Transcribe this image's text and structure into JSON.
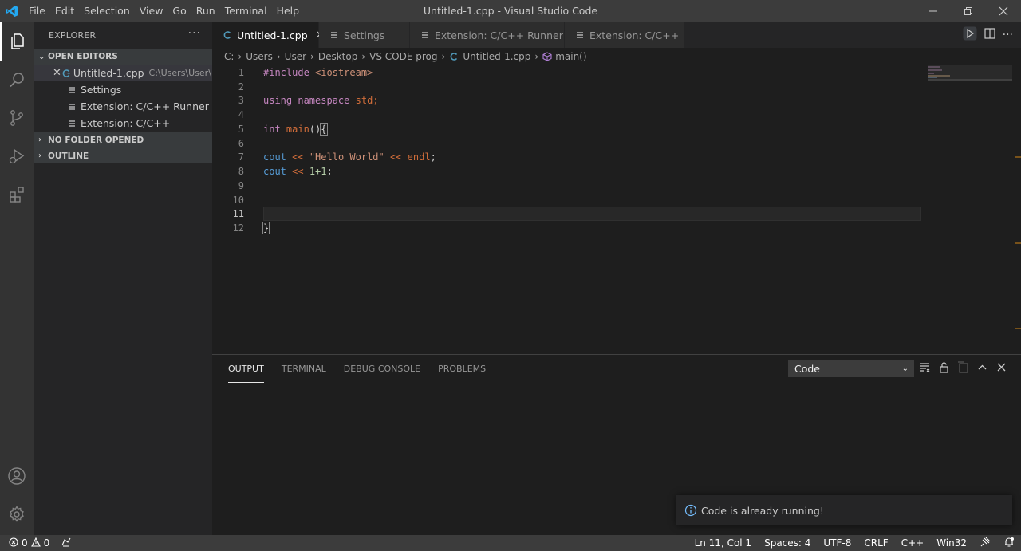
{
  "titlebar": {
    "title": "Untitled-1.cpp - Visual Studio Code",
    "menu": [
      "File",
      "Edit",
      "Selection",
      "View",
      "Go",
      "Run",
      "Terminal",
      "Help"
    ]
  },
  "sidebar": {
    "title": "EXPLORER",
    "open_editors_label": "OPEN EDITORS",
    "open_editors": [
      {
        "name": "Untitled-1.cpp",
        "path": "C:\\Users\\User\\...",
        "icon": "cpp-file-icon"
      },
      {
        "name": "Settings",
        "icon": "settings-file-icon"
      },
      {
        "name": "Extension: C/C++ Runner",
        "icon": "extension-file-icon"
      },
      {
        "name": "Extension: C/C++",
        "icon": "extension-file-icon"
      }
    ],
    "no_folder_label": "NO FOLDER OPENED",
    "outline_label": "OUTLINE"
  },
  "tabs": [
    {
      "label": "Untitled-1.cpp",
      "active": true
    },
    {
      "label": "Settings"
    },
    {
      "label": "Extension: C/C++ Runner"
    },
    {
      "label": "Extension: C/C++"
    }
  ],
  "breadcrumb": [
    "C:",
    "Users",
    "User",
    "Desktop",
    "VS CODE prog",
    "Untitled-1.cpp",
    "main()"
  ],
  "editor": {
    "lines": [
      {
        "n": "1"
      },
      {
        "n": "2"
      },
      {
        "n": "3"
      },
      {
        "n": "4"
      },
      {
        "n": "5"
      },
      {
        "n": "6"
      },
      {
        "n": "7"
      },
      {
        "n": "8"
      },
      {
        "n": "9"
      },
      {
        "n": "10"
      },
      {
        "n": "11"
      },
      {
        "n": "12"
      }
    ],
    "code": {
      "l1_kw": "#include",
      "l1_inc": "<iostream>",
      "l3_kw1": "using",
      "l3_kw2": "namespace",
      "l3_ns": "std",
      "l3_semi": ";",
      "l5_type": "int",
      "l5_fn": "main",
      "l5_paren": "()",
      "l5_brace": "{",
      "l7_cout": "cout",
      "l7_op": "<<",
      "l7_str": "\"Hello World\"",
      "l7_op2": "<<",
      "l7_endl": "endl",
      "l7_semi": ";",
      "l8_cout": "cout",
      "l8_op": "<<",
      "l8_expr": "1+1",
      "l8_semi": ";",
      "l12_brace": "}"
    }
  },
  "panel": {
    "tabs": [
      "OUTPUT",
      "TERMINAL",
      "DEBUG CONSOLE",
      "PROBLEMS"
    ],
    "active_tab": "OUTPUT",
    "channel": "Code"
  },
  "toast": {
    "message": "Code is already running!"
  },
  "statusbar": {
    "errors": "0",
    "warnings": "0",
    "position": "Ln 11, Col 1",
    "spaces": "Spaces: 4",
    "encoding": "UTF-8",
    "eol": "CRLF",
    "language": "C++",
    "platform": "Win32"
  },
  "colors": {
    "accent": "#007acc",
    "keyword": "#c586c0",
    "string": "#ce9178",
    "cout": "#569cd6",
    "operator": "#d16d3a",
    "function": "#dcdcaa"
  }
}
